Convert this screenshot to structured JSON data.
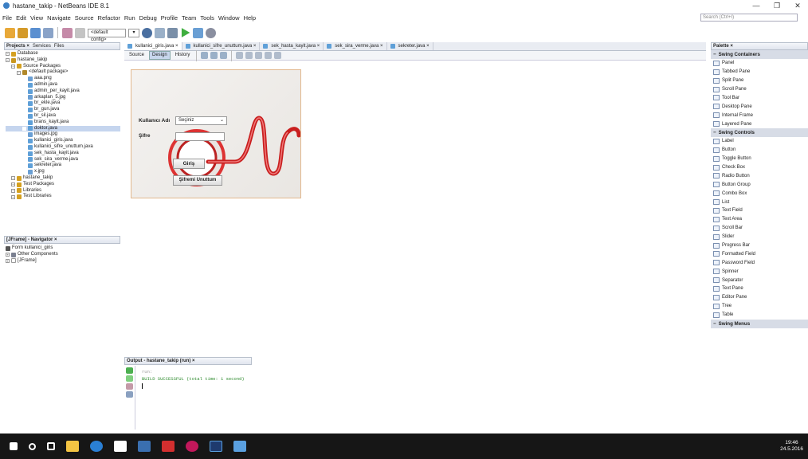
{
  "window": {
    "title": "hastane_takip - NetBeans IDE 8.1",
    "min": "—",
    "max": "❐",
    "close": "✕"
  },
  "menu": [
    "File",
    "Edit",
    "View",
    "Navigate",
    "Source",
    "Refactor",
    "Run",
    "Debug",
    "Profile",
    "Team",
    "Tools",
    "Window",
    "Help"
  ],
  "search_placeholder": "Search (Ctrl+I)",
  "toolbar": {
    "config": "<default config>"
  },
  "projects": {
    "tabs": [
      "Projects ×",
      "Services",
      "Files"
    ],
    "tree": [
      {
        "t": "Database",
        "l": 0,
        "c": "#d4a020"
      },
      {
        "t": "hastane_takip",
        "l": 0,
        "c": "#c9961e"
      },
      {
        "t": "Source Packages",
        "l": 1,
        "c": "#d4a020"
      },
      {
        "t": "<default package>",
        "l": 2,
        "c": "#b0882a"
      },
      {
        "t": "aaa.png",
        "l": 3,
        "c": "#6a9fd4"
      },
      {
        "t": "admin.java",
        "l": 3,
        "c": "#5fa0d8"
      },
      {
        "t": "admin_per_kayit.java",
        "l": 3,
        "c": "#5fa0d8"
      },
      {
        "t": "arkaplan_5.jpg",
        "l": 3,
        "c": "#6a9fd4"
      },
      {
        "t": "br_ekle.java",
        "l": 3,
        "c": "#5fa0d8"
      },
      {
        "t": "br_gun.java",
        "l": 3,
        "c": "#5fa0d8"
      },
      {
        "t": "br_sil.java",
        "l": 3,
        "c": "#5fa0d8"
      },
      {
        "t": "brans_kayit.java",
        "l": 3,
        "c": "#5fa0d8"
      },
      {
        "t": "doktor.java",
        "l": 3,
        "c": "#5fa0d8",
        "sel": true
      },
      {
        "t": "images.jpg",
        "l": 3,
        "c": "#6a9fd4"
      },
      {
        "t": "kullanici_giris.java",
        "l": 3,
        "c": "#5fa0d8"
      },
      {
        "t": "kullanici_sifre_unuttum.java",
        "l": 3,
        "c": "#5fa0d8"
      },
      {
        "t": "sek_hasta_kayit.java",
        "l": 3,
        "c": "#5fa0d8"
      },
      {
        "t": "sek_sira_verme.java",
        "l": 3,
        "c": "#5fa0d8"
      },
      {
        "t": "sekreter.java",
        "l": 3,
        "c": "#5fa0d8"
      },
      {
        "t": "x.jpg",
        "l": 3,
        "c": "#6a9fd4"
      },
      {
        "t": "hastane_takip",
        "l": 1,
        "c": "#d4a020"
      },
      {
        "t": "Test Packages",
        "l": 1,
        "c": "#d4a020"
      },
      {
        "t": "Libraries",
        "l": 1,
        "c": "#d4a020"
      },
      {
        "t": "Test Libraries",
        "l": 1,
        "c": "#d4a020"
      }
    ]
  },
  "navigator": {
    "title": "[JFrame] - Navigator ×",
    "tree": [
      {
        "t": "Form kullanici_giris",
        "l": 0
      },
      {
        "t": "Other Components",
        "l": 0
      },
      {
        "t": "[JFrame]",
        "l": 0
      }
    ]
  },
  "editor_tabs": [
    "kullanici_giris.java ×",
    "kullanici_sifre_unuttum.java ×",
    "sek_hasta_kayit.java ×",
    "sek_sira_verme.java ×",
    "sekreter.java ×"
  ],
  "design": {
    "source": "Source",
    "design": "Design",
    "history": "History"
  },
  "form": {
    "user_label": "Kullanıcı Adı",
    "combo": "Seçiniz",
    "password_label": "Şifre",
    "login_btn": "Giriş",
    "forgot_btn": "Şifremi Unuttum"
  },
  "palette": {
    "title": "Palette ×",
    "items": [
      {
        "t": "Swing Containers",
        "cat": true
      },
      {
        "t": "Panel"
      },
      {
        "t": "Tabbed Pane"
      },
      {
        "t": "Split Pane"
      },
      {
        "t": "Scroll Pane"
      },
      {
        "t": "Tool Bar"
      },
      {
        "t": "Desktop Pane"
      },
      {
        "t": "Internal Frame"
      },
      {
        "t": "Layered Pane"
      },
      {
        "t": "Swing Controls",
        "cat": true
      },
      {
        "t": "Label"
      },
      {
        "t": "Button"
      },
      {
        "t": "Toggle Button"
      },
      {
        "t": "Check Box"
      },
      {
        "t": "Radio Button"
      },
      {
        "t": "Button Group"
      },
      {
        "t": "Combo Box"
      },
      {
        "t": "List"
      },
      {
        "t": "Text Field"
      },
      {
        "t": "Text Area"
      },
      {
        "t": "Scroll Bar"
      },
      {
        "t": "Slider"
      },
      {
        "t": "Progress Bar"
      },
      {
        "t": "Formatted Field"
      },
      {
        "t": "Password Field"
      },
      {
        "t": "Spinner"
      },
      {
        "t": "Separator"
      },
      {
        "t": "Text Pane"
      },
      {
        "t": "Editor Pane"
      },
      {
        "t": "Tree"
      },
      {
        "t": "Table"
      },
      {
        "t": "Swing Menus",
        "cat": true
      }
    ]
  },
  "output": {
    "title": "Output - hastane_takip (run) ×",
    "line1": "run:",
    "line2": "BUILD SUCCESSFUL (total time: 1 second)"
  },
  "clock": {
    "time": "19:46",
    "date": "24.5.2016"
  }
}
